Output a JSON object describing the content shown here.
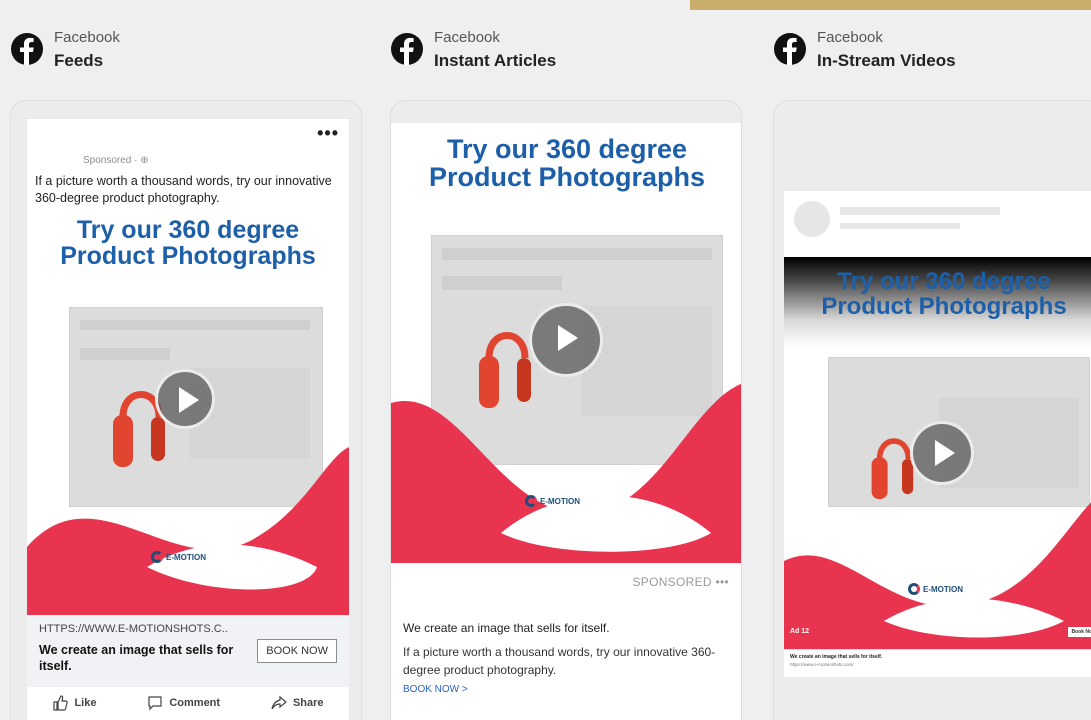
{
  "placements": [
    {
      "brand": "Facebook",
      "name": "Feeds"
    },
    {
      "brand": "Facebook",
      "name": "Instant Articles"
    },
    {
      "brand": "Facebook",
      "name": "In-Stream Videos"
    }
  ],
  "creative": {
    "headline_line1": "Try our 360 degree",
    "headline_line2": "Product Photographs",
    "logo_text": "E-MOTION"
  },
  "feeds": {
    "more_icon": "•••",
    "sponsored": "Sponsored · ⊕",
    "primary_text": "If a picture worth a thousand words, try our innovative 360-degree product photography.",
    "link_url": "HTTPS://WWW.E-MOTIONSHOTS.C...",
    "link_title": "We create an image that sells for itself.",
    "cta": "BOOK NOW",
    "actions": {
      "like": "Like",
      "comment": "Comment",
      "share": "Share"
    }
  },
  "instant_articles": {
    "sponsored": "SPONSORED •••",
    "text1": "We create an image that sells for itself.",
    "text2": "If a picture worth a thousand words, try our innovative 360-degree product photography.",
    "cta": "BOOK NOW >"
  },
  "instream": {
    "ad_label": "Ad 12",
    "cta": "Book Now",
    "caption1": "We create an image that sells for itself.",
    "caption2": "https://www.e-motionshots.com/"
  },
  "colors": {
    "accent_blue": "#1d5fa8",
    "brand_red": "#e8344f",
    "gold": "#c9ad6a"
  }
}
